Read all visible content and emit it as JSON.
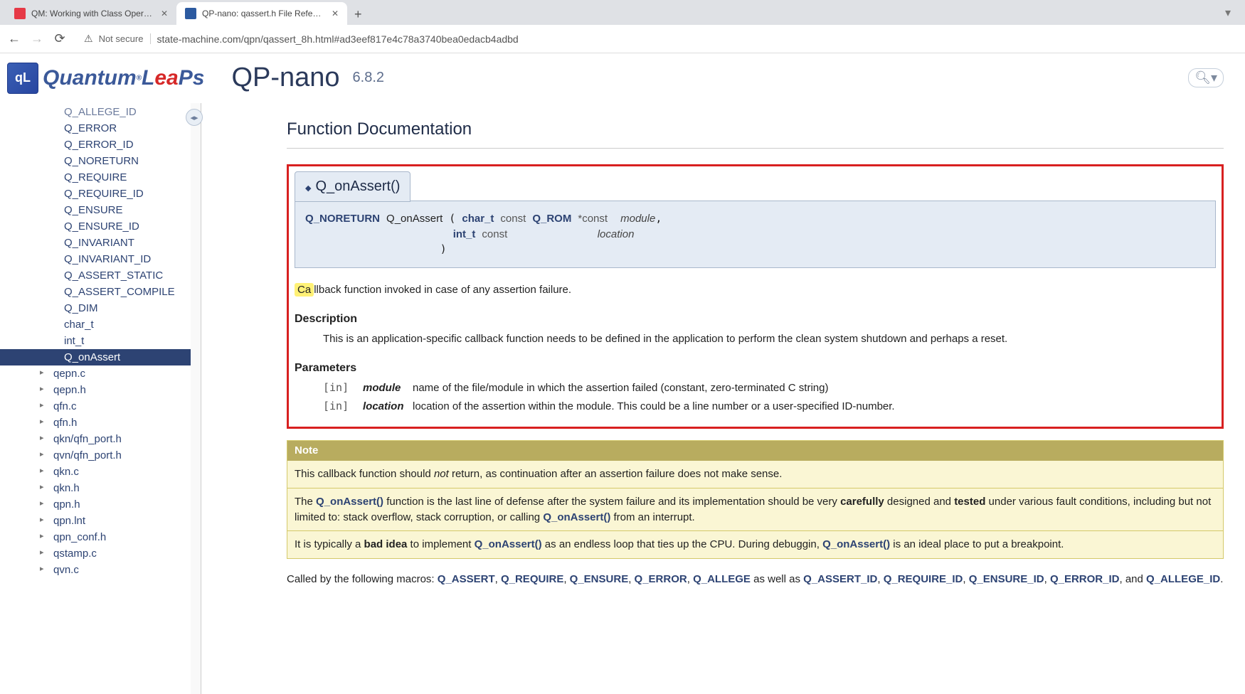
{
  "browser": {
    "tabs": [
      {
        "title": "QM: Working with Class Operati…"
      },
      {
        "title": "QP-nano: qassert.h File Referenc…"
      }
    ],
    "not_secure": "Not secure",
    "url": "state-machine.com/qpn/qassert_8h.html#ad3eef817e4c78a3740bea0edacb4adbd"
  },
  "header": {
    "logo_brand": "Quantum",
    "logo_suffix": "LeaPs",
    "project": "QP-nano",
    "version": "6.8.2"
  },
  "sidebar": {
    "items": [
      "Q_ALLEGE_ID",
      "Q_ERROR",
      "Q_ERROR_ID",
      "Q_NORETURN",
      "Q_REQUIRE",
      "Q_REQUIRE_ID",
      "Q_ENSURE",
      "Q_ENSURE_ID",
      "Q_INVARIANT",
      "Q_INVARIANT_ID",
      "Q_ASSERT_STATIC",
      "Q_ASSERT_COMPILE",
      "Q_DIM",
      "char_t",
      "int_t",
      "Q_onAssert"
    ],
    "files": [
      "qepn.c",
      "qepn.h",
      "qfn.c",
      "qfn.h",
      "qkn/qfn_port.h",
      "qvn/qfn_port.h",
      "qkn.c",
      "qkn.h",
      "qpn.h",
      "qpn.lnt",
      "qpn_conf.h",
      "qstamp.c",
      "qvn.c"
    ]
  },
  "content": {
    "section_title": "Function Documentation",
    "func_name": "Q_onAssert()",
    "sig": {
      "ret": "Q_NORETURN",
      "name": "Q_onAssert",
      "p1_type": "char_t",
      "p1_qual": "const",
      "p1_rom": "Q_ROM",
      "p1_ptr": "*const",
      "p1_name": "module",
      "p2_type": "int_t",
      "p2_qual": "const",
      "p2_name": "location"
    },
    "brief": "Callback function invoked in case of any assertion failure.",
    "brief_hl": "Ca",
    "brief_rest": "llback function invoked in case of any assertion failure.",
    "desc_heading": "Description",
    "desc_body": "This is an application-specific callback function needs to be defined in the application to perform the clean system shutdown and perhaps a reset.",
    "params_heading": "Parameters",
    "params": [
      {
        "dir": "[in]",
        "name": "module",
        "desc": "name of the file/module in which the assertion failed (constant, zero-terminated C string)"
      },
      {
        "dir": "[in]",
        "name": "location",
        "desc": "location of the assertion within the module. This could be a line number or a user-specified ID-number."
      }
    ],
    "note_title": "Note",
    "note1_a": "This callback function should ",
    "note1_not": "not",
    "note1_b": " return, as continuation after an assertion failure does not make sense.",
    "note2_a": "The ",
    "note2_fn": "Q_onAssert()",
    "note2_b": " function is the last line of defense after the system failure and its implementation should be very ",
    "note2_careful": "carefully",
    "note2_c": " designed and ",
    "note2_tested": "tested",
    "note2_d": " under various fault conditions, including but not limited to: stack overflow, stack corruption, or calling ",
    "note2_fn2": "Q_onAssert()",
    "note2_e": " from an interrupt.",
    "note3_a": "It is typically a ",
    "note3_bad": "bad idea",
    "note3_b": " to implement ",
    "note3_fn": "Q_onAssert()",
    "note3_c": " as an endless loop that ties up the CPU. During debuggin, ",
    "note3_fn2": "Q_onAssert()",
    "note3_d": " is an ideal place to put a breakpoint.",
    "called_a": "Called by the following macros: ",
    "macros1": [
      "Q_ASSERT",
      "Q_REQUIRE",
      "Q_ENSURE",
      "Q_ERROR",
      "Q_ALLEGE"
    ],
    "called_b": " as well as ",
    "macros2": [
      "Q_ASSERT_ID",
      "Q_REQUIRE_ID",
      "Q_ENSURE_ID",
      "Q_ERROR_ID"
    ],
    "called_c": ", and ",
    "macro_last": "Q_ALLEGE_ID",
    "called_d": "."
  }
}
